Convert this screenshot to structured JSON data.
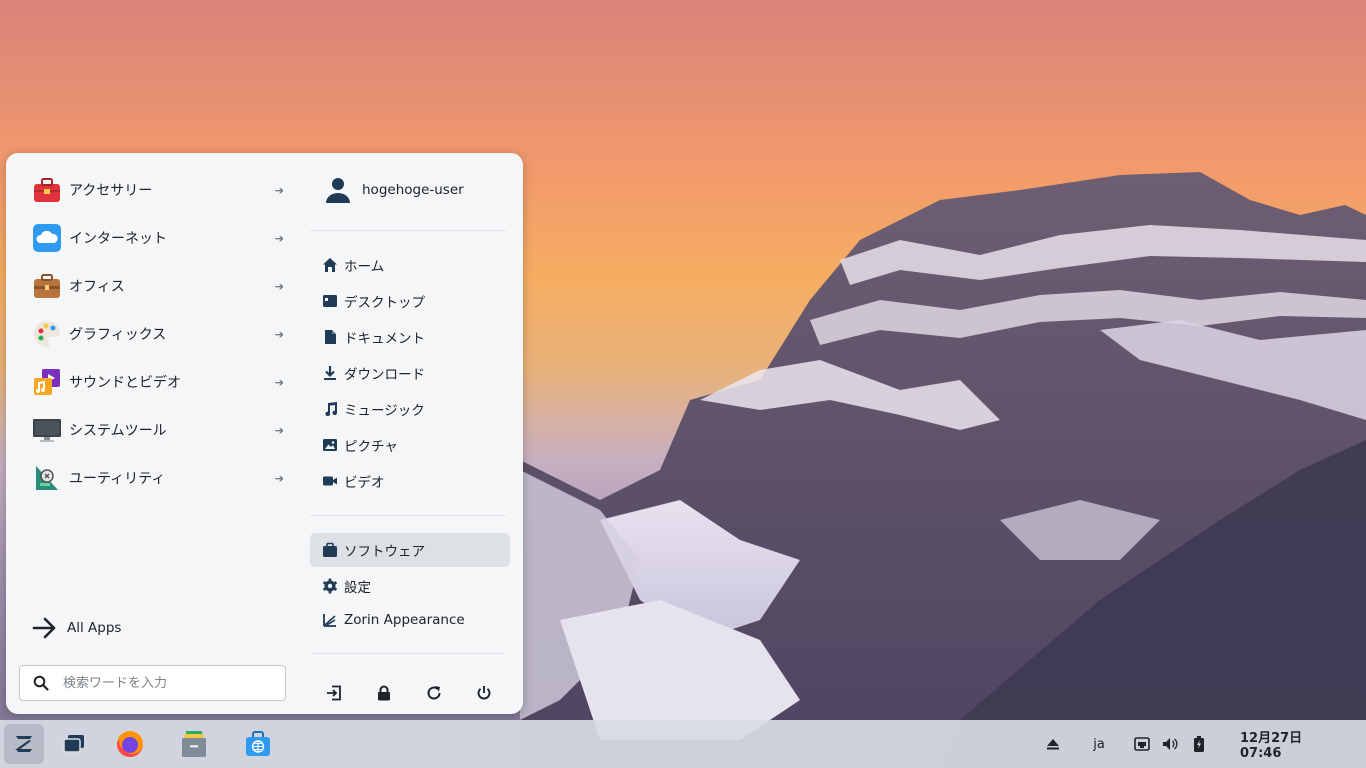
{
  "start_menu": {
    "categories": [
      {
        "label": "アクセサリー",
        "icon": "toolbox-icon"
      },
      {
        "label": "インターネット",
        "icon": "cloud-icon"
      },
      {
        "label": "オフィス",
        "icon": "briefcase-icon"
      },
      {
        "label": "グラフィックス",
        "icon": "palette-icon"
      },
      {
        "label": "サウンドとビデオ",
        "icon": "media-icon"
      },
      {
        "label": "システムツール",
        "icon": "monitor-icon"
      },
      {
        "label": "ユーティリティ",
        "icon": "utilities-icon"
      }
    ],
    "all_apps_label": "All Apps",
    "search": {
      "placeholder": "検索ワードを入力",
      "value": ""
    },
    "user": {
      "name": "hogehoge-user"
    },
    "places": [
      {
        "label": "ホーム",
        "icon": "home-icon"
      },
      {
        "label": "デスクトップ",
        "icon": "desktop-folder-icon"
      },
      {
        "label": "ドキュメント",
        "icon": "document-icon"
      },
      {
        "label": "ダウンロード",
        "icon": "download-icon"
      },
      {
        "label": "ミュージック",
        "icon": "music-icon"
      },
      {
        "label": "ピクチャ",
        "icon": "picture-icon"
      },
      {
        "label": "ビデオ",
        "icon": "video-icon"
      }
    ],
    "system": [
      {
        "label": "ソフトウェア",
        "icon": "software-bag-icon",
        "active": true
      },
      {
        "label": "設定",
        "icon": "gear-icon"
      },
      {
        "label": "Zorin Appearance",
        "icon": "appearance-icon"
      }
    ],
    "session_buttons": [
      "logout-icon",
      "lock-icon",
      "restart-icon",
      "power-icon"
    ]
  },
  "taskbar": {
    "apps": [
      "zorin-menu-icon",
      "workspaces-icon",
      "firefox-icon",
      "files-icon",
      "software-store-icon"
    ],
    "tray": {
      "language": "ja",
      "clock": "12月27日 07:46"
    }
  }
}
